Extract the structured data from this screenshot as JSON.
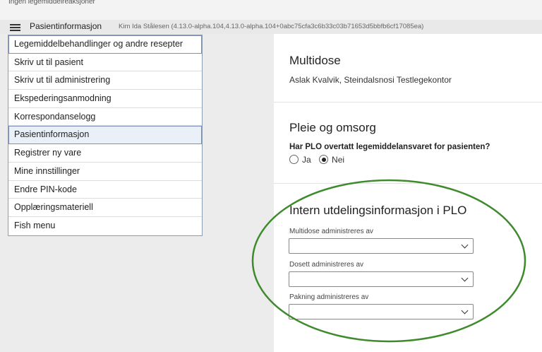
{
  "top_notice": "Ingen legemiddelreaksjoner",
  "app_bar": {
    "title": "Pasientinformasjon",
    "subtitle": "Kim Ida Stålesen (4.13.0-alpha.104,4.13.0-alpha.104+0abc75cfa3c6b33c03b71653d5bbfb6cf17085ea)"
  },
  "menu": {
    "items": [
      {
        "label": "Legemiddelbehandlinger og andre resepter"
      },
      {
        "label": "Skriv ut til pasient"
      },
      {
        "label": "Skriv ut til administrering"
      },
      {
        "label": "Ekspederingsanmodning"
      },
      {
        "label": "Korrespondanselogg"
      },
      {
        "label": "Pasientinformasjon"
      },
      {
        "label": "Registrer ny vare"
      },
      {
        "label": "Mine innstillinger"
      },
      {
        "label": "Endre PIN-kode"
      },
      {
        "label": "Opplæringsmateriell"
      },
      {
        "label": "Fish menu"
      }
    ],
    "selected": "Pasientinformasjon"
  },
  "multidose": {
    "title": "Multidose",
    "text": "Aslak Kvalvik, Steindalsnosi Testlegekontor"
  },
  "pleie": {
    "title": "Pleie og omsorg",
    "question": "Har PLO overtatt legemiddelansvaret for pasienten?",
    "options": [
      "Ja",
      "Nei"
    ],
    "selected": "Nei"
  },
  "intern": {
    "title": "Intern utdelingsinformasjon i PLO",
    "fields": [
      {
        "label": "Multidose administreres av",
        "value": ""
      },
      {
        "label": "Dosett administreres av",
        "value": ""
      },
      {
        "label": "Pakning administreres av",
        "value": ""
      }
    ]
  },
  "colors": {
    "highlight_ellipse": "#3e8a2c",
    "menu_border": "#8a9db5",
    "side_background": "#ececec"
  }
}
